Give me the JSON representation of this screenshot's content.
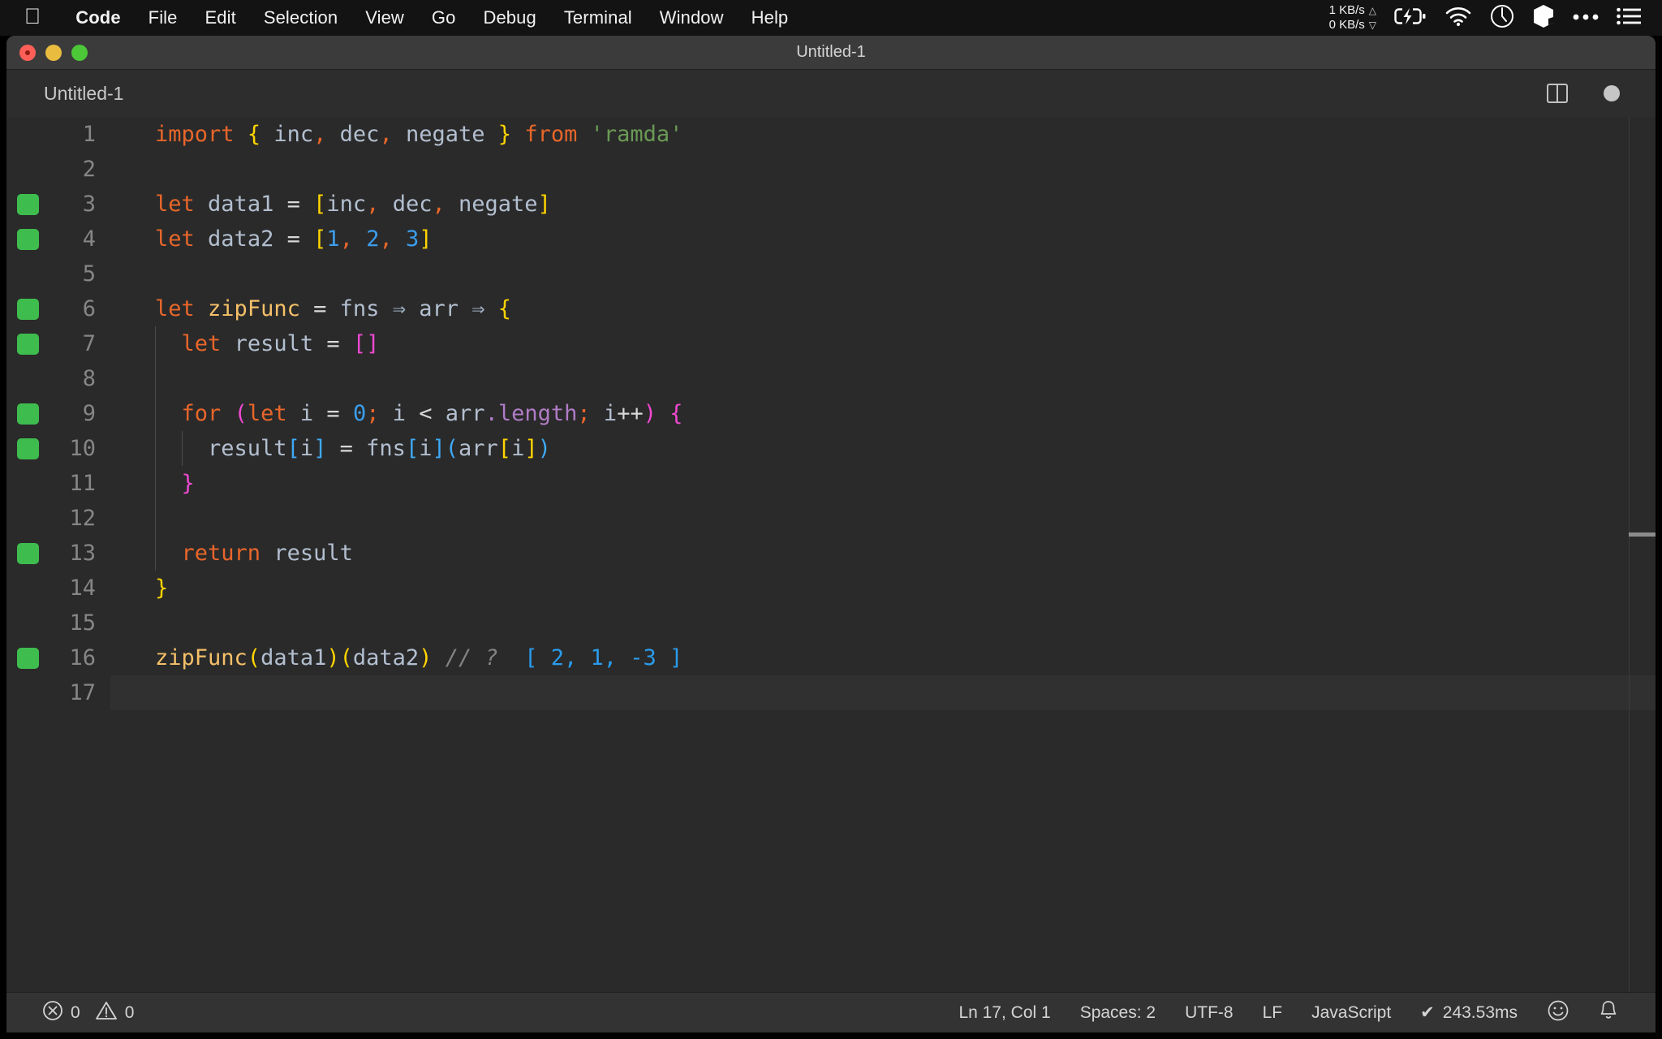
{
  "menubar": {
    "apple_icon": "apple-logo",
    "items": [
      {
        "label": "Code",
        "bold": true
      },
      {
        "label": "File"
      },
      {
        "label": "Edit"
      },
      {
        "label": "Selection"
      },
      {
        "label": "View"
      },
      {
        "label": "Go"
      },
      {
        "label": "Debug"
      },
      {
        "label": "Terminal"
      },
      {
        "label": "Window"
      },
      {
        "label": "Help"
      }
    ],
    "tray": {
      "network_up": "1 KB/s",
      "network_down": "0 KB/s",
      "up_arrow": "△",
      "down_arrow": "▽",
      "battery_icon": "battery-charging-icon",
      "wifi_icon": "wifi-icon",
      "clock_icon": "clock-icon",
      "box_icon": "box-icon",
      "ellipsis_icon": "ellipsis-icon",
      "list_icon": "list-icon"
    }
  },
  "window": {
    "title": "Untitled-1",
    "close_label": "close",
    "minimize_label": "minimize",
    "maximize_label": "maximize"
  },
  "tabbar": {
    "tabs": [
      {
        "label": "Untitled-1",
        "dirty": true
      }
    ],
    "split_editor_label": "Split Editor",
    "more_actions_label": "More Actions"
  },
  "editor": {
    "lines": [
      {
        "number": "1",
        "covered": false,
        "indent_guides": 0,
        "tokens": [
          {
            "t": "import",
            "c": "k"
          },
          {
            "t": " ",
            "c": "op"
          },
          {
            "t": "{",
            "c": "b1"
          },
          {
            "t": " ",
            "c": "op"
          },
          {
            "t": "inc",
            "c": "id"
          },
          {
            "t": ",",
            "c": "pnc"
          },
          {
            "t": " ",
            "c": "op"
          },
          {
            "t": "dec",
            "c": "id"
          },
          {
            "t": ",",
            "c": "pnc"
          },
          {
            "t": " ",
            "c": "op"
          },
          {
            "t": "negate",
            "c": "id"
          },
          {
            "t": " ",
            "c": "op"
          },
          {
            "t": "}",
            "c": "b1"
          },
          {
            "t": " ",
            "c": "op"
          },
          {
            "t": "from",
            "c": "k"
          },
          {
            "t": " ",
            "c": "op"
          },
          {
            "t": "'ramda'",
            "c": "str"
          }
        ]
      },
      {
        "number": "2",
        "covered": false,
        "indent_guides": 0,
        "tokens": []
      },
      {
        "number": "3",
        "covered": true,
        "indent_guides": 0,
        "tokens": [
          {
            "t": "let",
            "c": "k"
          },
          {
            "t": " ",
            "c": "op"
          },
          {
            "t": "data1",
            "c": "id"
          },
          {
            "t": " ",
            "c": "op"
          },
          {
            "t": "=",
            "c": "op"
          },
          {
            "t": " ",
            "c": "op"
          },
          {
            "t": "[",
            "c": "b1"
          },
          {
            "t": "inc",
            "c": "id"
          },
          {
            "t": ",",
            "c": "pnc"
          },
          {
            "t": " ",
            "c": "op"
          },
          {
            "t": "dec",
            "c": "id"
          },
          {
            "t": ",",
            "c": "pnc"
          },
          {
            "t": " ",
            "c": "op"
          },
          {
            "t": "negate",
            "c": "id"
          },
          {
            "t": "]",
            "c": "b1"
          }
        ]
      },
      {
        "number": "4",
        "covered": true,
        "indent_guides": 0,
        "tokens": [
          {
            "t": "let",
            "c": "k"
          },
          {
            "t": " ",
            "c": "op"
          },
          {
            "t": "data2",
            "c": "id"
          },
          {
            "t": " ",
            "c": "op"
          },
          {
            "t": "=",
            "c": "op"
          },
          {
            "t": " ",
            "c": "op"
          },
          {
            "t": "[",
            "c": "b1"
          },
          {
            "t": "1",
            "c": "num"
          },
          {
            "t": ",",
            "c": "pnc"
          },
          {
            "t": " ",
            "c": "op"
          },
          {
            "t": "2",
            "c": "num"
          },
          {
            "t": ",",
            "c": "pnc"
          },
          {
            "t": " ",
            "c": "op"
          },
          {
            "t": "3",
            "c": "num"
          },
          {
            "t": "]",
            "c": "b1"
          }
        ]
      },
      {
        "number": "5",
        "covered": false,
        "indent_guides": 0,
        "tokens": []
      },
      {
        "number": "6",
        "covered": true,
        "indent_guides": 0,
        "tokens": [
          {
            "t": "let",
            "c": "k"
          },
          {
            "t": " ",
            "c": "op"
          },
          {
            "t": "zipFunc",
            "c": "fn"
          },
          {
            "t": " ",
            "c": "op"
          },
          {
            "t": "=",
            "c": "op"
          },
          {
            "t": " ",
            "c": "op"
          },
          {
            "t": "fns",
            "c": "id"
          },
          {
            "t": " ",
            "c": "op"
          },
          {
            "t": "⇒",
            "c": "arw"
          },
          {
            "t": " ",
            "c": "op"
          },
          {
            "t": "arr",
            "c": "id"
          },
          {
            "t": " ",
            "c": "op"
          },
          {
            "t": "⇒",
            "c": "arw"
          },
          {
            "t": " ",
            "c": "op"
          },
          {
            "t": "{",
            "c": "b1"
          }
        ]
      },
      {
        "number": "7",
        "covered": true,
        "indent_guides": 1,
        "tokens": [
          {
            "t": "  ",
            "c": "op"
          },
          {
            "t": "let",
            "c": "k"
          },
          {
            "t": " ",
            "c": "op"
          },
          {
            "t": "result",
            "c": "id"
          },
          {
            "t": " ",
            "c": "op"
          },
          {
            "t": "=",
            "c": "op"
          },
          {
            "t": " ",
            "c": "op"
          },
          {
            "t": "[]",
            "c": "b2"
          }
        ]
      },
      {
        "number": "8",
        "covered": false,
        "indent_guides": 1,
        "tokens": []
      },
      {
        "number": "9",
        "covered": true,
        "indent_guides": 1,
        "tokens": [
          {
            "t": "  ",
            "c": "op"
          },
          {
            "t": "for",
            "c": "k"
          },
          {
            "t": " ",
            "c": "op"
          },
          {
            "t": "(",
            "c": "b2"
          },
          {
            "t": "let",
            "c": "k"
          },
          {
            "t": " ",
            "c": "op"
          },
          {
            "t": "i",
            "c": "id"
          },
          {
            "t": " ",
            "c": "op"
          },
          {
            "t": "=",
            "c": "op"
          },
          {
            "t": " ",
            "c": "op"
          },
          {
            "t": "0",
            "c": "num"
          },
          {
            "t": ";",
            "c": "pnc"
          },
          {
            "t": " ",
            "c": "op"
          },
          {
            "t": "i",
            "c": "id"
          },
          {
            "t": " ",
            "c": "op"
          },
          {
            "t": "<",
            "c": "op"
          },
          {
            "t": " ",
            "c": "op"
          },
          {
            "t": "arr",
            "c": "id"
          },
          {
            "t": ".",
            "c": "prop"
          },
          {
            "t": "length",
            "c": "prop"
          },
          {
            "t": ";",
            "c": "pnc"
          },
          {
            "t": " ",
            "c": "op"
          },
          {
            "t": "i",
            "c": "id"
          },
          {
            "t": "++",
            "c": "op"
          },
          {
            "t": ")",
            "c": "b2"
          },
          {
            "t": " ",
            "c": "op"
          },
          {
            "t": "{",
            "c": "b2"
          }
        ]
      },
      {
        "number": "10",
        "covered": true,
        "indent_guides": 2,
        "tokens": [
          {
            "t": "    ",
            "c": "op"
          },
          {
            "t": "result",
            "c": "id"
          },
          {
            "t": "[",
            "c": "b3"
          },
          {
            "t": "i",
            "c": "id"
          },
          {
            "t": "]",
            "c": "b3"
          },
          {
            "t": " ",
            "c": "op"
          },
          {
            "t": "=",
            "c": "op"
          },
          {
            "t": " ",
            "c": "op"
          },
          {
            "t": "fns",
            "c": "id"
          },
          {
            "t": "[",
            "c": "b3"
          },
          {
            "t": "i",
            "c": "id"
          },
          {
            "t": "]",
            "c": "b3"
          },
          {
            "t": "(",
            "c": "b3"
          },
          {
            "t": "arr",
            "c": "id"
          },
          {
            "t": "[",
            "c": "b1"
          },
          {
            "t": "i",
            "c": "id"
          },
          {
            "t": "]",
            "c": "b1"
          },
          {
            "t": ")",
            "c": "b3"
          }
        ]
      },
      {
        "number": "11",
        "covered": false,
        "indent_guides": 1,
        "tokens": [
          {
            "t": "  ",
            "c": "op"
          },
          {
            "t": "}",
            "c": "b2"
          }
        ]
      },
      {
        "number": "12",
        "covered": false,
        "indent_guides": 1,
        "tokens": []
      },
      {
        "number": "13",
        "covered": true,
        "indent_guides": 1,
        "tokens": [
          {
            "t": "  ",
            "c": "op"
          },
          {
            "t": "return",
            "c": "k"
          },
          {
            "t": " ",
            "c": "op"
          },
          {
            "t": "result",
            "c": "id"
          }
        ]
      },
      {
        "number": "14",
        "covered": false,
        "indent_guides": 0,
        "tokens": [
          {
            "t": "}",
            "c": "b1"
          }
        ]
      },
      {
        "number": "15",
        "covered": false,
        "indent_guides": 0,
        "tokens": []
      },
      {
        "number": "16",
        "covered": true,
        "indent_guides": 0,
        "tokens": [
          {
            "t": "zipFunc",
            "c": "fn"
          },
          {
            "t": "(",
            "c": "b1"
          },
          {
            "t": "data1",
            "c": "id"
          },
          {
            "t": ")",
            "c": "b1"
          },
          {
            "t": "(",
            "c": "b1"
          },
          {
            "t": "data2",
            "c": "id"
          },
          {
            "t": ")",
            "c": "b1"
          },
          {
            "t": " ",
            "c": "op"
          },
          {
            "t": "// ?",
            "c": "cmt"
          },
          {
            "t": "  ",
            "c": "op"
          },
          {
            "t": "[ 2, 1, -3 ]",
            "c": "res"
          }
        ]
      },
      {
        "number": "17",
        "covered": false,
        "indent_guides": 0,
        "current": true,
        "tokens": []
      }
    ]
  },
  "statusbar": {
    "error_icon": "error-circle-icon",
    "error_count": "0",
    "warning_icon": "warning-triangle-icon",
    "warning_count": "0",
    "cursor_position": "Ln 17, Col 1",
    "indentation": "Spaces: 2",
    "encoding": "UTF-8",
    "eol": "LF",
    "language": "JavaScript",
    "quokka_check": "✔",
    "quokka_time": "243.53ms",
    "feedback_icon": "smiley-icon",
    "notifications_icon": "bell-icon"
  }
}
